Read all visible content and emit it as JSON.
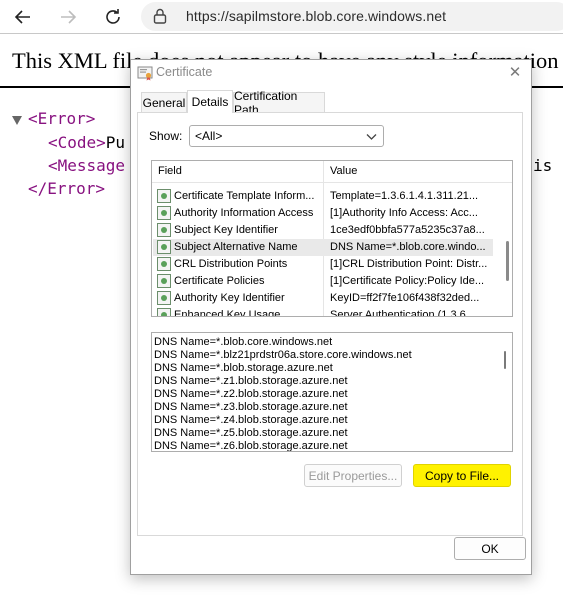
{
  "browser": {
    "url": "https://sapilmstore.blob.core.windows.net"
  },
  "page": {
    "heading": "This XML file does not appear to have any style information associated with it.",
    "xml": {
      "error_open": "<Error>",
      "code_open": "<Code>",
      "code_text": "Pu",
      "message_open": "<Message",
      "message_tail": "is",
      "error_close": "</Error>"
    }
  },
  "dialog": {
    "title": "Certificate",
    "close_label": "✕",
    "tabs": [
      {
        "label": "General",
        "active": false
      },
      {
        "label": "Details",
        "active": true
      },
      {
        "label": "Certification Path",
        "active": false
      }
    ],
    "show_label": "Show:",
    "show_value": "<All>",
    "columns": {
      "field": "Field",
      "value": "Value"
    },
    "rows": [
      {
        "field": "Certificate Template Inform...",
        "value": "Template=1.3.6.1.4.1.311.21...",
        "selected": false
      },
      {
        "field": "Authority Information Access",
        "value": "[1]Authority Info Access: Acc...",
        "selected": false
      },
      {
        "field": "Subject Key Identifier",
        "value": "1ce3edf0bbfa577a5235c37a8...",
        "selected": false
      },
      {
        "field": "Subject Alternative Name",
        "value": "DNS Name=*.blob.core.windo...",
        "selected": true
      },
      {
        "field": "CRL Distribution Points",
        "value": "[1]CRL Distribution Point: Distr...",
        "selected": false
      },
      {
        "field": "Certificate Policies",
        "value": "[1]Certificate Policy:Policy Ide...",
        "selected": false
      },
      {
        "field": "Authority Key Identifier",
        "value": "KeyID=ff2f7fe106f438f32ded...",
        "selected": false
      },
      {
        "field": "Enhanced Key Usage",
        "value": "Server Authentication (1.3.6...",
        "selected": false
      }
    ],
    "value_lines": [
      "DNS Name=*.blob.core.windows.net",
      "DNS Name=*.blz21prdstr06a.store.core.windows.net",
      "DNS Name=*.blob.storage.azure.net",
      "DNS Name=*.z1.blob.storage.azure.net",
      "DNS Name=*.z2.blob.storage.azure.net",
      "DNS Name=*.z3.blob.storage.azure.net",
      "DNS Name=*.z4.blob.storage.azure.net",
      "DNS Name=*.z5.blob.storage.azure.net",
      "DNS Name=*.z6.blob.storage.azure.net"
    ],
    "buttons": {
      "edit_properties": "Edit Properties...",
      "copy_to_file": "Copy to File...",
      "ok": "OK"
    },
    "highlight_color": "#fff200"
  }
}
